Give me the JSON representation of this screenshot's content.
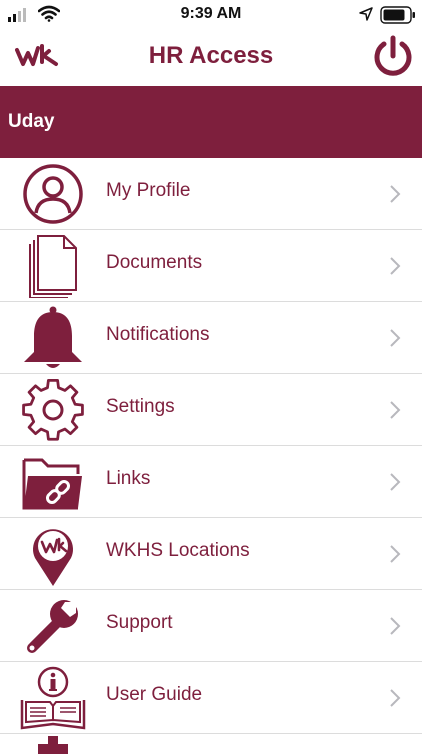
{
  "status_bar": {
    "time": "9:39 AM",
    "icons": [
      "signal-icon",
      "wifi-icon",
      "location-arrow-icon",
      "battery-icon"
    ]
  },
  "header": {
    "title": "HR Access",
    "logo_icon": "wk-logo-icon",
    "power_icon": "power-icon"
  },
  "user": {
    "name": "Uday"
  },
  "menu": {
    "items": [
      {
        "label": "My Profile",
        "icon": "profile-icon"
      },
      {
        "label": "Documents",
        "icon": "documents-icon"
      },
      {
        "label": "Notifications",
        "icon": "bell-icon"
      },
      {
        "label": "Settings",
        "icon": "gear-icon"
      },
      {
        "label": "Links",
        "icon": "folder-link-icon"
      },
      {
        "label": "WKHS Locations",
        "icon": "location-pin-icon"
      },
      {
        "label": "Support",
        "icon": "wrench-icon"
      },
      {
        "label": "User Guide",
        "icon": "user-guide-icon"
      }
    ]
  },
  "colors": {
    "brand": "#7e1f3d",
    "divider": "#dcdcdc",
    "chevron": "#b8b8bd"
  }
}
